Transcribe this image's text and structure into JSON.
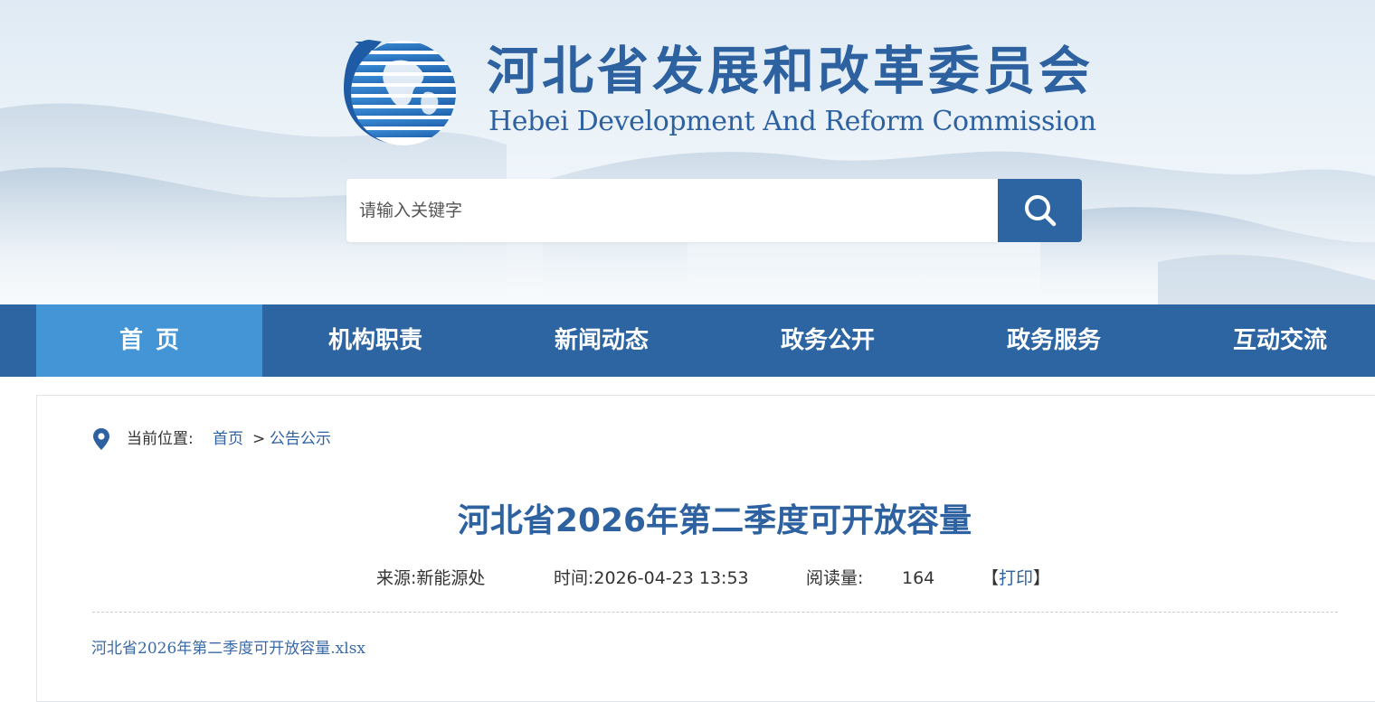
{
  "header": {
    "title_cn": "河北省发展和改革委员会",
    "title_en": "Hebei Development And Reform Commission",
    "logo_icon": "globe-swirl-logo",
    "accent": "#2d61a0"
  },
  "search": {
    "placeholder": "请输入关键字",
    "value": "",
    "button_icon": "search-icon",
    "button_color": "#2d65a3"
  },
  "nav": {
    "bar_color": "#2d65a3",
    "active_color": "#4395d6",
    "items": [
      {
        "label": "首页",
        "active": true
      },
      {
        "label": "机构职责",
        "active": false
      },
      {
        "label": "新闻动态",
        "active": false
      },
      {
        "label": "政务公开",
        "active": false
      },
      {
        "label": "政务服务",
        "active": false
      },
      {
        "label": "互动交流",
        "active": false
      }
    ]
  },
  "breadcrumb": {
    "icon": "location-pin-icon",
    "label": "当前位置:",
    "items": [
      "首页",
      "公告公示"
    ],
    "separator": ">"
  },
  "article": {
    "title": "河北省2026年第二季度可开放容量",
    "source": "来源:新能源处",
    "time": "时间:2026-04-23 13:53",
    "views_label": "阅读量:",
    "views": "164",
    "print_open": "【",
    "print_label": "打印",
    "print_close": "】",
    "attachment": "河北省2026年第二季度可开放容量.xlsx"
  }
}
